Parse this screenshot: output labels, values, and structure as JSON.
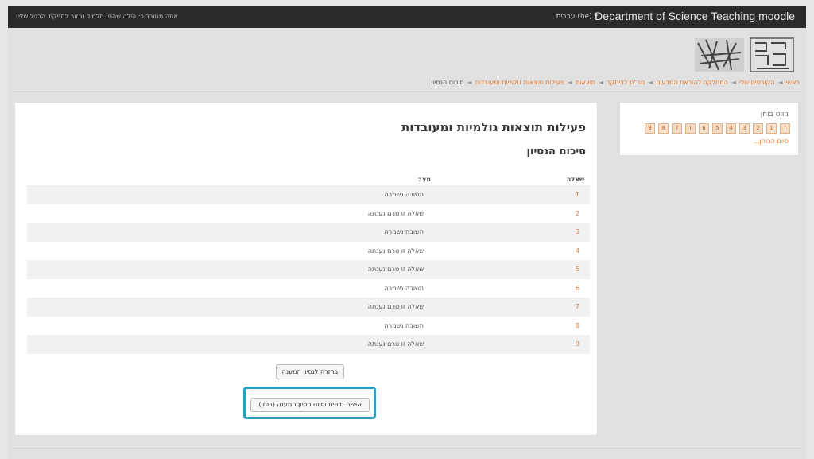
{
  "header": {
    "site_name": "Department of Science Teaching moodle",
    "language": "עברית (he) ▾",
    "login_info": "אתה מחובר כ: הילה שהם: תלמיד (חזור לתפקיד הרגיל שלי)"
  },
  "breadcrumb": {
    "items": [
      "ראשי",
      "הקורסים שלי",
      "המחלקה להוראת המדעים",
      "מב\"ם לביחקר",
      "תוצאות",
      "פעילות תוצאות גולמיות ומעובדות"
    ],
    "current": "סיכום הנסיון"
  },
  "quiz_nav": {
    "title": "ניווט בוחן",
    "buttons": [
      "i",
      "1",
      "2",
      "3",
      "4",
      "5",
      "6",
      "i",
      "7",
      "8",
      "9"
    ],
    "summary_link": "סיום הבוחן..."
  },
  "main": {
    "title": "פעילות תוצאות גולמיות ומעובדות",
    "subtitle": "סיכום הנסיון",
    "table": {
      "col_question": "שאלה",
      "col_status": "מצב",
      "rows": [
        {
          "num": "1",
          "status": "תשובה נשמרה"
        },
        {
          "num": "2",
          "status": "שאלה זו טרם נענתה"
        },
        {
          "num": "3",
          "status": "תשובה נשמרה"
        },
        {
          "num": "4",
          "status": "שאלה זו טרם נענתה"
        },
        {
          "num": "5",
          "status": "שאלה זו טרם נענתה"
        },
        {
          "num": "6",
          "status": "תשובה נשמרה"
        },
        {
          "num": "7",
          "status": "שאלה זו טרם נענתה"
        },
        {
          "num": "8",
          "status": "תשובה נשמרה"
        },
        {
          "num": "9",
          "status": "שאלה זו טרם נענתה"
        }
      ]
    },
    "return_button": "בחזרה לנסיון המענה",
    "submit_button": "הגשה סופית וסיום ניסיון המענה (בוחן)"
  },
  "colors": {
    "link": "#ef7b2e",
    "highlight": "#2a9fbf",
    "topbar": "#2b2b2b"
  }
}
